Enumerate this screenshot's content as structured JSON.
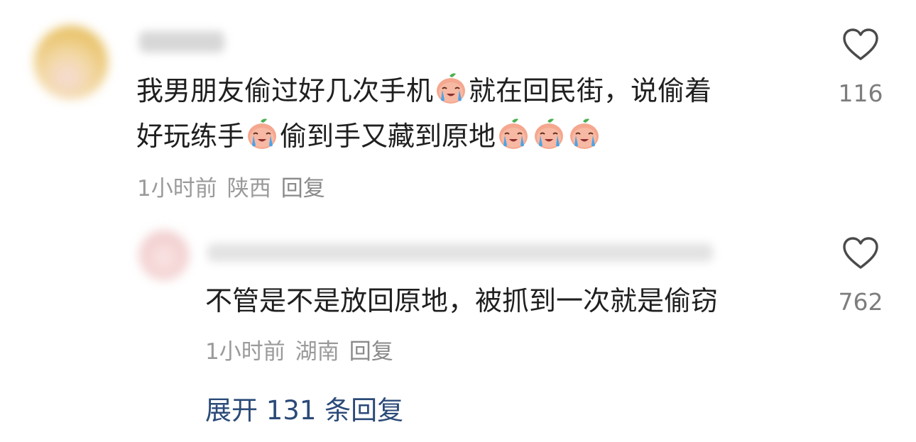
{
  "comments": [
    {
      "text_line1_a": "我男朋友偷过好几次手机",
      "text_line1_b": "就在回民街，说偷着",
      "text_line2_a": "好玩练手",
      "text_line2_b": "偷到手又藏到原地",
      "emoji": "crying-peach-emoji",
      "time": "1小时前",
      "location": "陕西",
      "reply_label": "回复",
      "like_count": "116"
    },
    {
      "text_line1": "不管是不是放回原地，被抓到一次就是偷窃",
      "time": "1小时前",
      "location": "湖南",
      "reply_label": "回复",
      "like_count": "762"
    }
  ],
  "expand_replies_label": "展开 131 条回复",
  "icons": {
    "like": "heart-outline-icon"
  },
  "colors": {
    "text": "#1f1f1f",
    "meta": "#9a9a9a",
    "link": "#2b4a78"
  }
}
